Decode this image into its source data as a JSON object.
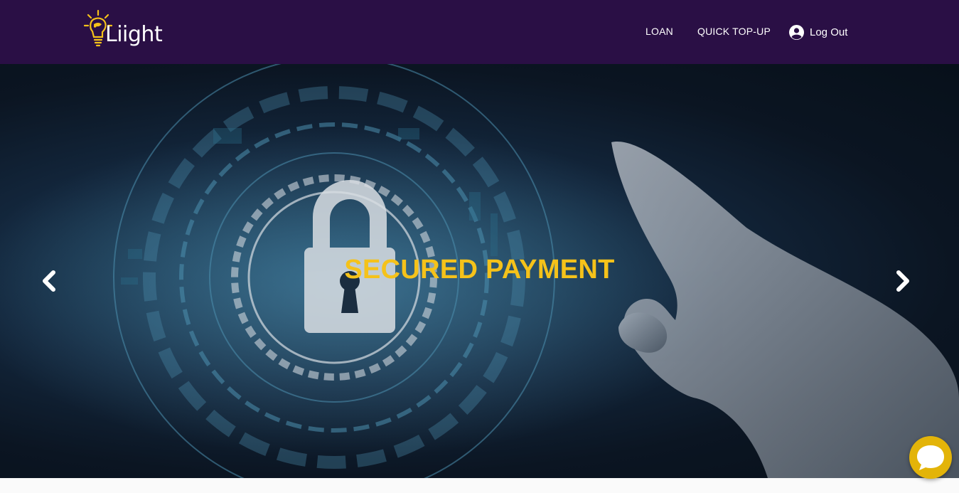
{
  "brand": {
    "name": "Liight"
  },
  "nav": {
    "loan_label": "LOAN",
    "topup_label": "QUICK TOP-UP",
    "logout_label": "Log Out"
  },
  "hero": {
    "title": "SECURED PAYMENT"
  },
  "icons": {
    "logo": "lightbulb-icon",
    "account": "user-circle-icon",
    "prev": "chevron-left-icon",
    "next": "chevron-right-icon",
    "chat": "chat-bubble-icon"
  },
  "colors": {
    "navbar": "#2a0f45",
    "accent": "#f5c21a",
    "chat_button": "#e3b409"
  }
}
